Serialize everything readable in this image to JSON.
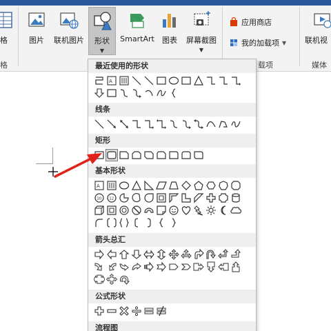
{
  "ribbon": {
    "left_partial_label": "格",
    "left_partial_group": "格",
    "picture_label": "图片",
    "online_picture_label": "联机图片",
    "shapes_label": "形状",
    "smartart_label": "SmartArt",
    "chart_label": "图表",
    "screenshot_label": "屏幕截图",
    "app_store_label": "应用商店",
    "my_addins_label": "我的加载项",
    "addins_group_label": "载项",
    "online_video_label": "联机视",
    "media_group_label": "媒体",
    "accent_color": "#2b579a",
    "store_icon_color": "#d83b01"
  },
  "gallery": {
    "sections": [
      {
        "title": "最近使用的形状"
      },
      {
        "title": "线条"
      },
      {
        "title": "矩形"
      },
      {
        "title": "基本形状"
      },
      {
        "title": "箭头总汇"
      },
      {
        "title": "公式形状"
      },
      {
        "title": "流程图"
      }
    ],
    "highlighted_shape": "rounded-rectangle",
    "arrow_color": "#e0221a"
  }
}
